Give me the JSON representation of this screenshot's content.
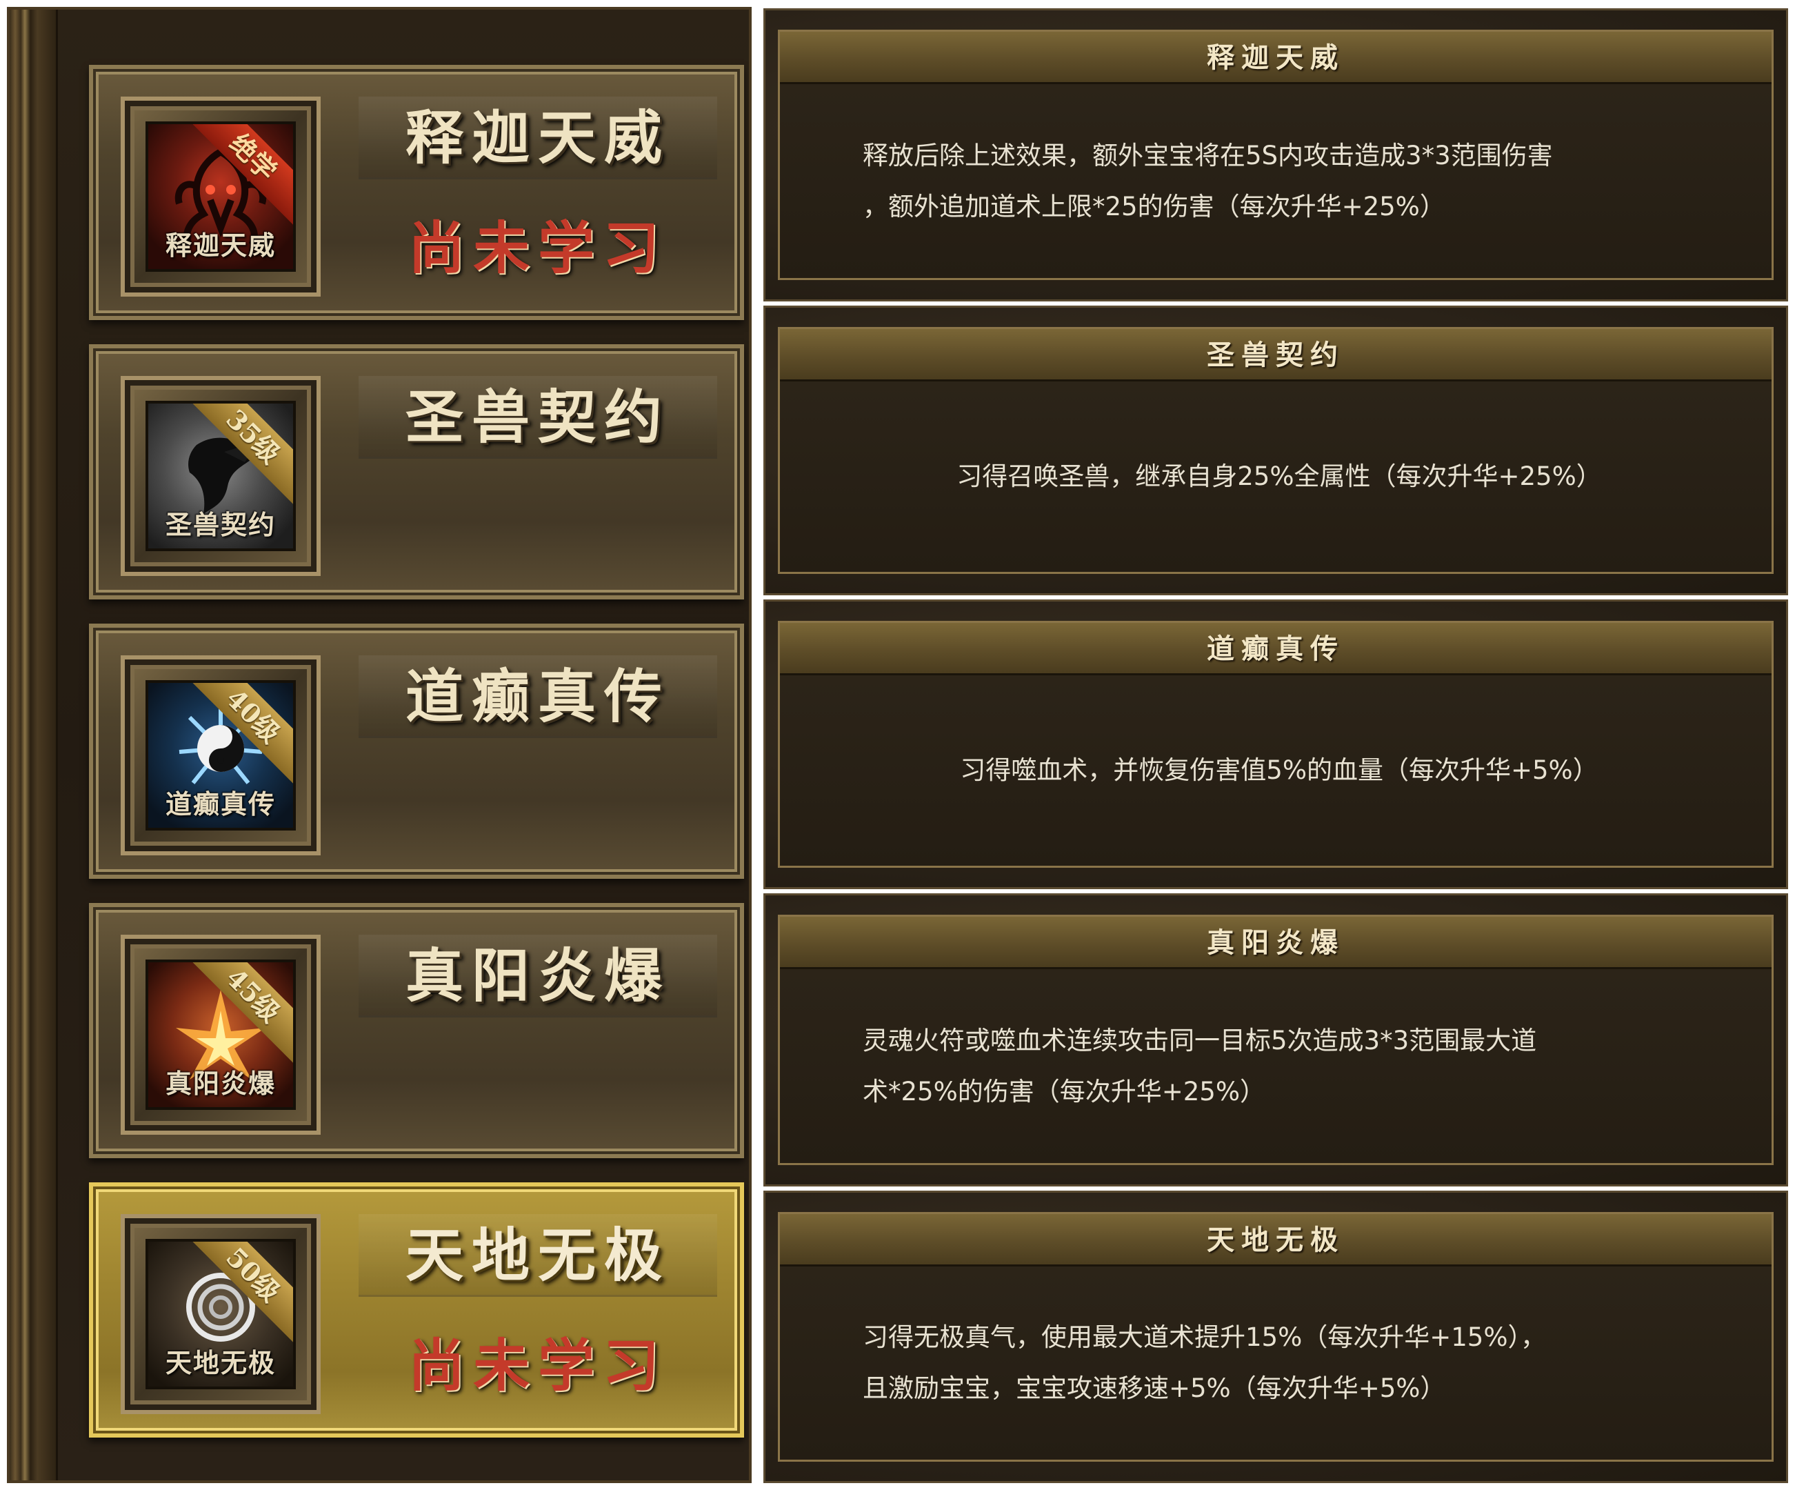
{
  "skills": [
    {
      "name": "释迦天威",
      "icon_caption": "释迦天威",
      "tag": "绝学",
      "status": "尚未学习",
      "icon": "demon-skill-icon",
      "accent": "#c42a1a"
    },
    {
      "name": "圣兽契约",
      "icon_caption": "圣兽契约",
      "tag": "35级",
      "status": "",
      "icon": "beast-skill-icon",
      "accent": "#8a6a24"
    },
    {
      "name": "道癫真传",
      "icon_caption": "道癫真传",
      "tag": "40级",
      "status": "",
      "icon": "yinyang-skill-icon",
      "accent": "#8a6a24"
    },
    {
      "name": "真阳炎爆",
      "icon_caption": "真阳炎爆",
      "tag": "45级",
      "status": "",
      "icon": "flame-skill-icon",
      "accent": "#8a6a24"
    },
    {
      "name": "天地无极",
      "icon_caption": "天地无极",
      "tag": "50级",
      "status": "尚未学习",
      "icon": "ring-skill-icon",
      "accent": "#e5c85a"
    }
  ],
  "cards": [
    {
      "title": "释迦天威",
      "lines": [
        "释放后除上述效果，额外宝宝将在5S内攻击造成3*3范围伤害",
        "，额外追加道术上限*25的伤害（每次升华+25%）"
      ]
    },
    {
      "title": "圣兽契约",
      "lines": [
        "习得召唤圣兽，继承自身25%全属性（每次升华+25%）"
      ]
    },
    {
      "title": "道癫真传",
      "lines": [
        "习得噬血术，并恢复伤害值5%的血量（每次升华+5%）"
      ]
    },
    {
      "title": "真阳炎爆",
      "lines": [
        "灵魂火符或噬血术连续攻击同一目标5次造成3*3范围最大道",
        "术*25%的伤害（每次升华+25%）"
      ]
    },
    {
      "title": "天地无极",
      "lines": [
        "习得无极真气，使用最大道术提升15%（每次升华+15%），",
        "且激励宝宝，宝宝攻速移速+5%（每次升华+5%）"
      ]
    }
  ],
  "colors": {
    "status_red": "#c43a2a",
    "active_gold": "#e5c85a",
    "text_light": "#e8e2d2"
  }
}
